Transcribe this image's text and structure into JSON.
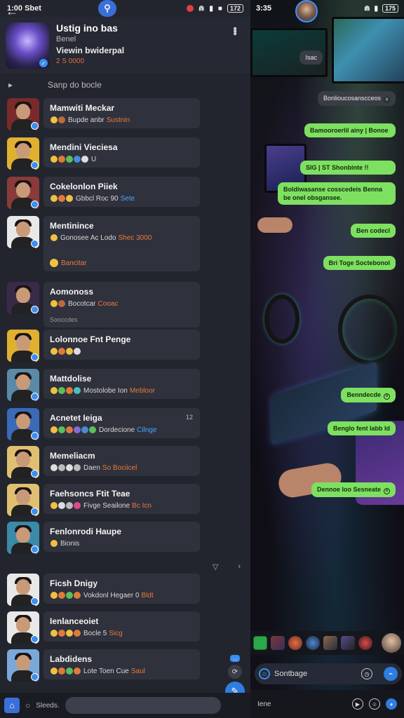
{
  "status_left": {
    "time": "1:00 Sbet",
    "battery": "172"
  },
  "status_right": {
    "time": "3:35",
    "battery": "175"
  },
  "header": {
    "title": "Ustig ino bas",
    "sub": "Benel",
    "sub2": "Viewin bwiderpal",
    "meta": "2 S 0000"
  },
  "section_title": "Sanp do bocle",
  "contacts": [
    {
      "name": "Mamwiti Meckar",
      "line": "Bupde anbr",
      "hl": "Sustnin",
      "hl_color": "orange",
      "emos": [
        "#f0c040",
        "#c06a3a"
      ],
      "av_bg": "#7a2a2a"
    },
    {
      "name": "Mendini Vieciesa",
      "line": "U",
      "hl": "",
      "hl_color": "orange",
      "emos": [
        "#f0c040",
        "#e07a3a",
        "#5ac05a",
        "#4a8ad8",
        "#ddd"
      ],
      "av_bg": "#e0b030"
    },
    {
      "name": "Cokelonlon Piiek",
      "line": "Gbbcl Roc 90",
      "hl": "Sete",
      "hl_color": "blue",
      "emos": [
        "#f0c040",
        "#e07a3a",
        "#f0c040"
      ],
      "av_bg": "#8a3a3a"
    },
    {
      "name": "Mentinince",
      "line": "Gonosee Ac Lodo",
      "hl": "Shec 3000",
      "hl_color": "orange",
      "extra": "Bancitar",
      "emos": [
        "#f0c040"
      ],
      "av_bg": "#e8e8e8"
    },
    {
      "name": "Aomonoss",
      "line": "Bocotcar",
      "hl": "Cooac",
      "hl_color": "orange",
      "extra2": "Sooccdes",
      "emos": [
        "#f0c040",
        "#c06a3a"
      ],
      "av_bg": "#3a2a4a"
    },
    {
      "name": "Lolonnoe Fnt Penge",
      "line": "",
      "hl": "",
      "hl_color": "orange",
      "emos": [
        "#f0c040",
        "#e07a3a",
        "#f0c040",
        "#ddd"
      ],
      "av_bg": "#e0b030"
    },
    {
      "name": "Mattdolise",
      "line": "Mostolobe Ion",
      "hl": "Mebloor",
      "hl_color": "orange",
      "emos": [
        "#f0c040",
        "#5ac05a",
        "#e07a3a",
        "#4ac0c0"
      ],
      "av_bg": "#5a8aa8"
    },
    {
      "name": "Acnetet Ieiga",
      "line": "Dordecione",
      "hl": "Cilnge",
      "hl_color": "blue",
      "count": "12",
      "emos": [
        "#f0c040",
        "#5ac05a",
        "#e07a3a",
        "#8a6ad8",
        "#4a8ad8",
        "#5ac05a"
      ],
      "av_bg": "#3a6ab8"
    },
    {
      "name": "Memeliacm",
      "line": "Daen",
      "hl": "So Bociicel",
      "hl_color": "orange",
      "emos": [
        "#ddd",
        "#bbb",
        "#ddd",
        "#bbb"
      ],
      "av_bg": "#e0c070"
    },
    {
      "name": "Faehsoncs Ftit Teae",
      "line": "Fivge Seailone",
      "hl": "Bc Icn",
      "hl_color": "orange",
      "emos": [
        "#f0c040",
        "#ddd",
        "#bbb",
        "#e04a8a"
      ],
      "av_bg": "#e0c070"
    },
    {
      "name": "Fenlonrodi Haupe",
      "line": "Bionis",
      "hl": "",
      "hl_color": "orange",
      "emos": [
        "#f0c040"
      ],
      "av_bg": "#3a8aa8"
    },
    {
      "name": "Ficsh Dnigy",
      "line": "Vokdonl Hegaer 0",
      "hl": "Bldt",
      "hl_color": "orange",
      "emos": [
        "#f0c040",
        "#e07a3a",
        "#5ac05a",
        "#e07a3a"
      ],
      "av_bg": "#e8e8e8"
    },
    {
      "name": "Ienlanceoiet",
      "line": "Bocle 5",
      "hl": "Sicg",
      "hl_color": "orange",
      "emos": [
        "#f0c040",
        "#e07a3a",
        "#f0c040",
        "#e07a3a"
      ],
      "av_bg": "#e8e8e8"
    },
    {
      "name": "Labdidens",
      "line": "Lote Toen Cue",
      "hl": "Saul",
      "hl_color": "orange",
      "emos": [
        "#f0c040",
        "#e07a3a",
        "#5ac05a",
        "#e07a3a"
      ],
      "av_bg": "#7aa8d8"
    }
  ],
  "bottom_bar": {
    "label": "Sleeds."
  },
  "messages": [
    {
      "dir": "in",
      "text": "Isac"
    },
    {
      "dir": "in",
      "text": "Bonlioucosanscceos",
      "tick": "x"
    },
    {
      "dir": "out",
      "text": "Bamooroerlil ainy | Bonoe",
      "tick": ""
    },
    {
      "dir": "out",
      "text": "SIG  | ST Shonbinte !!",
      "tick": ""
    },
    {
      "dir": "out",
      "text": "Boldiwasanse cosscedeis Benna be onel obsgansee.",
      "tick": ""
    },
    {
      "dir": "out",
      "text": "Ben codecl",
      "tick": ""
    },
    {
      "dir": "out",
      "text": "Bri Toge Soctebonol",
      "tick": ""
    },
    {
      "dir": "out",
      "text": "Benndecde",
      "tick": "o"
    },
    {
      "dir": "out",
      "text": "Benglo fent labb Id",
      "tick": ""
    },
    {
      "dir": "out",
      "text": "Dennoe Ioo Sesneate",
      "tick": "o"
    }
  ],
  "compose": {
    "text": "Sontbage"
  },
  "bottom_right": {
    "label": "Iene"
  }
}
